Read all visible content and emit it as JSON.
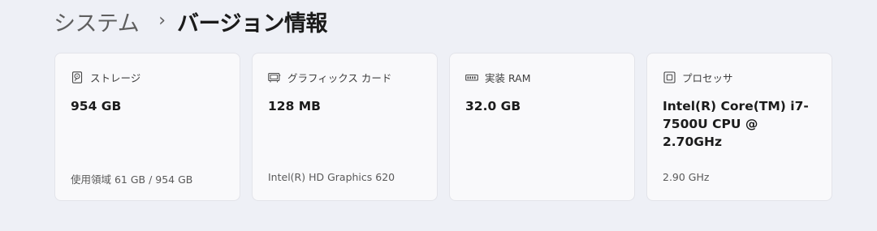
{
  "breadcrumb": {
    "parent": "システム",
    "separator": "›",
    "current": "バージョン情報"
  },
  "cards": [
    {
      "icon": "storage-drive-icon",
      "label": "ストレージ",
      "value": "954 GB",
      "sub": "使用領域 61 GB / 954 GB"
    },
    {
      "icon": "graphics-card-icon",
      "label": "グラフィックス カード",
      "value": "128 MB",
      "sub": "Intel(R) HD Graphics 620"
    },
    {
      "icon": "memory-ram-icon",
      "label": "実装 RAM",
      "value": "32.0 GB",
      "sub": ""
    },
    {
      "icon": "processor-chip-icon",
      "label": "プロセッサ",
      "value": "Intel(R) Core(TM) i7-7500U CPU @ 2.70GHz",
      "sub": "2.90 GHz"
    }
  ],
  "colors": {
    "background": "#eef0f6",
    "card": "#f9f9fb",
    "card_border": "#e3e4ea"
  }
}
